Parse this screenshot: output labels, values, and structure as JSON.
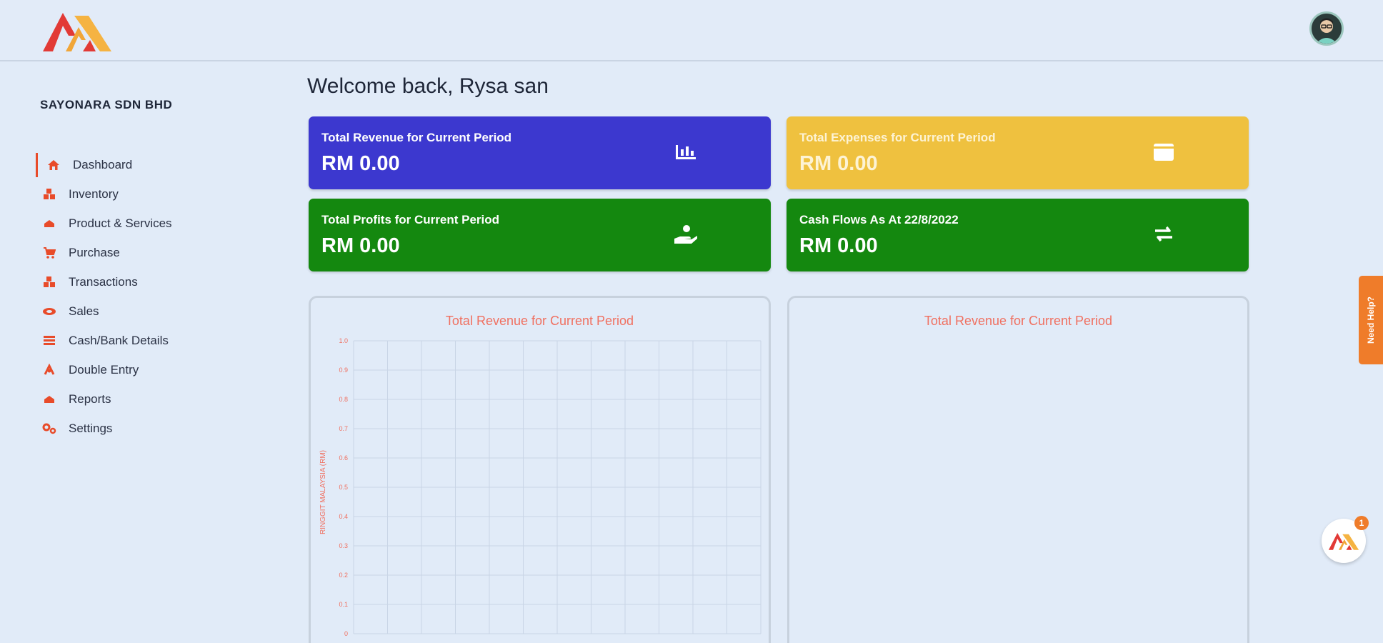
{
  "company": "SAYONARA SDN BHD",
  "welcome": "Welcome back, Rysa san",
  "nav": [
    {
      "label": "Dashboard",
      "icon": "home-icon",
      "active": true
    },
    {
      "label": "Inventory",
      "icon": "boxes-icon"
    },
    {
      "label": "Product & Services",
      "icon": "product-icon"
    },
    {
      "label": "Purchase",
      "icon": "cart-icon"
    },
    {
      "label": "Transactions",
      "icon": "transactions-icon"
    },
    {
      "label": "Sales",
      "icon": "handshake-icon"
    },
    {
      "label": "Cash/Bank Details",
      "icon": "bank-icon"
    },
    {
      "label": "Double Entry",
      "icon": "double-entry-icon"
    },
    {
      "label": "Reports",
      "icon": "reports-icon"
    },
    {
      "label": "Settings",
      "icon": "settings-icon"
    }
  ],
  "cards": [
    {
      "title": "Total Revenue for Current Period",
      "value": "RM 0.00",
      "icon": "chart-icon",
      "color": "#3c38cf"
    },
    {
      "title": "Total Expenses for Current Period",
      "value": "RM 0.00",
      "icon": "wallet-icon",
      "color": "#efc13f"
    },
    {
      "title": "Total Profits for Current Period",
      "value": "RM 0.00",
      "icon": "hand-coin-icon",
      "color": "#14880f"
    },
    {
      "title": "Cash Flows As At 22/8/2022",
      "value": "RM 0.00",
      "icon": "exchange-icon",
      "color": "#14880f"
    }
  ],
  "panels": [
    {
      "title": "Total Revenue for Current Period"
    },
    {
      "title": "Total Revenue for Current Period"
    }
  ],
  "chart_data": {
    "type": "line",
    "title": "Total Revenue for Current Period",
    "ylabel": "RINGGIT MALAYSIA (RM)",
    "ylim": [
      0,
      1
    ],
    "yticks": [
      "0",
      "0.1",
      "0.2",
      "0.3",
      "0.4",
      "0.5",
      "0.6",
      "0.7",
      "0.8",
      "0.9",
      "1.0"
    ],
    "series": [],
    "grid": true
  },
  "help_tab": "Need Help?",
  "bubble_badge": "1",
  "colors": {
    "accent": "#e84b2a",
    "help": "#ef7c2a",
    "chart_text": "#f07060"
  }
}
